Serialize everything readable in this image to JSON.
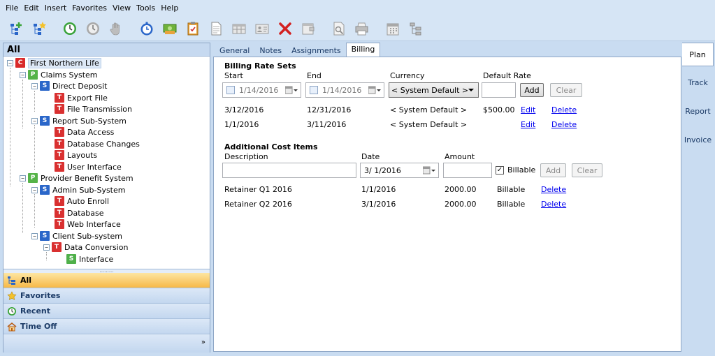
{
  "menu": [
    "File",
    "Edit",
    "Insert",
    "Favorites",
    "View",
    "Tools",
    "Help"
  ],
  "left": {
    "header": "All",
    "tree": [
      {
        "label": "First Northern Life",
        "badge": "C"
      },
      {
        "label": "Claims System",
        "badge": "P"
      },
      {
        "label": "Direct Deposit",
        "badge": "S"
      },
      {
        "label": "Export File",
        "badge": "T"
      },
      {
        "label": "File Transmission",
        "badge": "T"
      },
      {
        "label": "Report Sub-System",
        "badge": "S"
      },
      {
        "label": "Data Access",
        "badge": "T"
      },
      {
        "label": "Database Changes",
        "badge": "T"
      },
      {
        "label": "Layouts",
        "badge": "T"
      },
      {
        "label": "User Interface",
        "badge": "T"
      },
      {
        "label": "Provider Benefit System",
        "badge": "P"
      },
      {
        "label": "Admin Sub-System",
        "badge": "S"
      },
      {
        "label": "Auto Enroll",
        "badge": "T"
      },
      {
        "label": "Database",
        "badge": "T"
      },
      {
        "label": "Web Interface",
        "badge": "T"
      },
      {
        "label": "Client Sub-system",
        "badge": "S"
      },
      {
        "label": "Data Conversion",
        "badge": "T"
      },
      {
        "label": "Interface",
        "badge": "S"
      }
    ],
    "nav": [
      "All",
      "Favorites",
      "Recent",
      "Time Off"
    ]
  },
  "tabs": [
    "General",
    "Notes",
    "Assignments",
    "Billing"
  ],
  "side_tabs": [
    "Plan",
    "Track",
    "Report",
    "Invoice"
  ],
  "billing": {
    "rate_title": "Billing Rate Sets",
    "col_start": "Start",
    "col_end": "End",
    "col_currency": "Currency",
    "col_default_rate": "Default Rate",
    "start_value": "1/14/2016",
    "end_value": "1/14/2016",
    "currency_value": "< System Default >",
    "default_rate_value": "",
    "add_label": "Add",
    "clear_label": "Clear",
    "rates": [
      {
        "start": "3/12/2016",
        "end": "12/31/2016",
        "currency": "< System Default >",
        "rate": "$500.00",
        "edit": "Edit",
        "delete": "Delete"
      },
      {
        "start": "1/1/2016",
        "end": "3/11/2016",
        "currency": "< System Default >",
        "rate": "",
        "edit": "Edit",
        "delete": "Delete"
      }
    ],
    "cost_title": "Additional Cost Items",
    "col_description": "Description",
    "col_date": "Date",
    "col_amount": "Amount",
    "description_value": "",
    "date_value": "3/ 1/2016",
    "amount_value": "",
    "billable_label": "Billable",
    "billable_checked": true,
    "costs": [
      {
        "description": "Retainer Q1 2016",
        "date": "1/1/2016",
        "amount": "2000.00",
        "billable": "Billable",
        "delete": "Delete"
      },
      {
        "description": "Retainer Q2 2016",
        "date": "3/1/2016",
        "amount": "2000.00",
        "billable": "Billable",
        "delete": "Delete"
      }
    ]
  }
}
